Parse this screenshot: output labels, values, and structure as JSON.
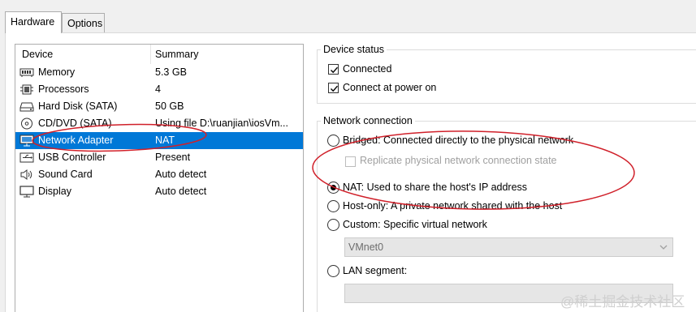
{
  "tabs": [
    {
      "label": "Hardware",
      "active": true
    },
    {
      "label": "Options",
      "active": false
    }
  ],
  "device_list": {
    "columns": [
      "Device",
      "Summary"
    ],
    "rows": [
      {
        "icon": "memory-icon",
        "name": "Memory",
        "summary": "5.3 GB",
        "selected": false
      },
      {
        "icon": "processor-icon",
        "name": "Processors",
        "summary": "4",
        "selected": false
      },
      {
        "icon": "hard-disk-icon",
        "name": "Hard Disk (SATA)",
        "summary": "50 GB",
        "selected": false
      },
      {
        "icon": "cd-dvd-icon",
        "name": "CD/DVD (SATA)",
        "summary": "Using file D:\\ruanjian\\iosVm...",
        "selected": false
      },
      {
        "icon": "network-adapter-icon",
        "name": "Network Adapter",
        "summary": "NAT",
        "selected": true
      },
      {
        "icon": "usb-icon",
        "name": "USB Controller",
        "summary": "Present",
        "selected": false
      },
      {
        "icon": "sound-icon",
        "name": "Sound Card",
        "summary": "Auto detect",
        "selected": false
      },
      {
        "icon": "display-icon",
        "name": "Display",
        "summary": "Auto detect",
        "selected": false
      }
    ]
  },
  "device_status": {
    "title": "Device status",
    "connected": {
      "label": "Connected",
      "checked": true
    },
    "connect_at_power_on": {
      "label": "Connect at power on",
      "checked": true
    }
  },
  "network_connection": {
    "title": "Network connection",
    "bridged": {
      "label": "Bridged: Connected directly to the physical network",
      "selected": false
    },
    "replicate": {
      "label": "Replicate physical network connection state",
      "checked": false,
      "enabled": false
    },
    "nat": {
      "label": "NAT: Used to share the host's IP address",
      "selected": true
    },
    "host_only": {
      "label": "Host-only: A private network shared with the host",
      "selected": false
    },
    "custom": {
      "label": "Custom: Specific virtual network",
      "selected": false
    },
    "vmnet_select": {
      "value": "VMnet0",
      "enabled": false
    },
    "lan_segment": {
      "label": "LAN segment:",
      "selected": false
    },
    "lan_segment_value": ""
  },
  "watermark": "@稀土掘金技术社区",
  "colors": {
    "selection": "#0078d7",
    "annotation": "#d0202a"
  }
}
